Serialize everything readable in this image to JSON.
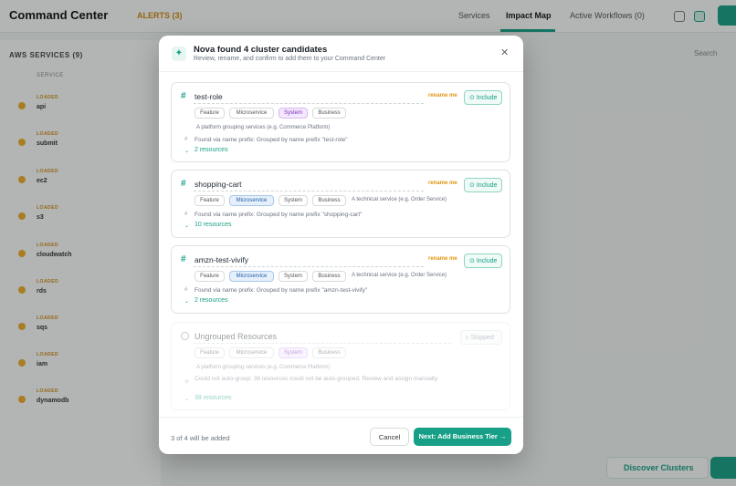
{
  "app": {
    "title": "Command Center",
    "alerts": "ALERTS (3)",
    "nav": [
      "Services",
      "Impact Map",
      "Active Workflows (0)"
    ],
    "left_heading": "AWS SERVICES (9)",
    "left_col": "SERVICE",
    "search": "Search",
    "services": [
      {
        "badge": "LOADED",
        "name": "api"
      },
      {
        "badge": "LOADED",
        "name": "submit"
      },
      {
        "badge": "LOADED",
        "name": "ec2"
      },
      {
        "badge": "LOADED",
        "name": "s3"
      },
      {
        "badge": "LOADED",
        "name": "cloudwatch"
      },
      {
        "badge": "LOADED",
        "name": "rds"
      },
      {
        "badge": "LOADED",
        "name": "sqs"
      },
      {
        "badge": "LOADED",
        "name": "iam"
      },
      {
        "badge": "LOADED",
        "name": "dynamodb"
      }
    ],
    "discover_button": "Discover Clusters"
  },
  "modal": {
    "title": "Nova found 4 cluster candidates",
    "subtitle": "Review, rename, and confirm to add them to your Command Center",
    "rename_label": "rename me",
    "include_label": "Include",
    "skipped_label": "Skipped",
    "tiers": [
      "Feature",
      "Microservice",
      "System",
      "Business"
    ],
    "candidates": [
      {
        "name": "test-role",
        "tier_desc": "A platform grouping services (e.g. Commerce Platform)",
        "found": "Found via name prefix: Grouped by name prefix \"test-role\"",
        "resources": "2 resources"
      },
      {
        "name": "shopping-cart",
        "tier_desc": "A technical service (e.g. Order Service)",
        "found": "Found via name prefix: Grouped by name prefix \"shopping-cart\"",
        "resources": "10 resources"
      },
      {
        "name": "amzn-test-vivify",
        "tier_desc": "A technical service (e.g. Order Service)",
        "found": "Found via name prefix: Grouped by name prefix \"amzn-test-vivify\"",
        "resources": "2 resources"
      },
      {
        "name": "Ungrouped Resources",
        "tier_desc": "A platform grouping services (e.g. Commerce Platform)",
        "found": "Could not auto-group: 38 resources could not be auto-grouped. Review and assign manually.",
        "resources": "38 resources"
      }
    ],
    "footer_count": "3 of 4 will be added",
    "cancel": "Cancel",
    "next": "Next: Add Business Tier →"
  },
  "colors": {
    "accent": "#17a087",
    "warning": "#e0940f",
    "system": "#7b2cbf",
    "microservice": "#1e5ea8"
  }
}
